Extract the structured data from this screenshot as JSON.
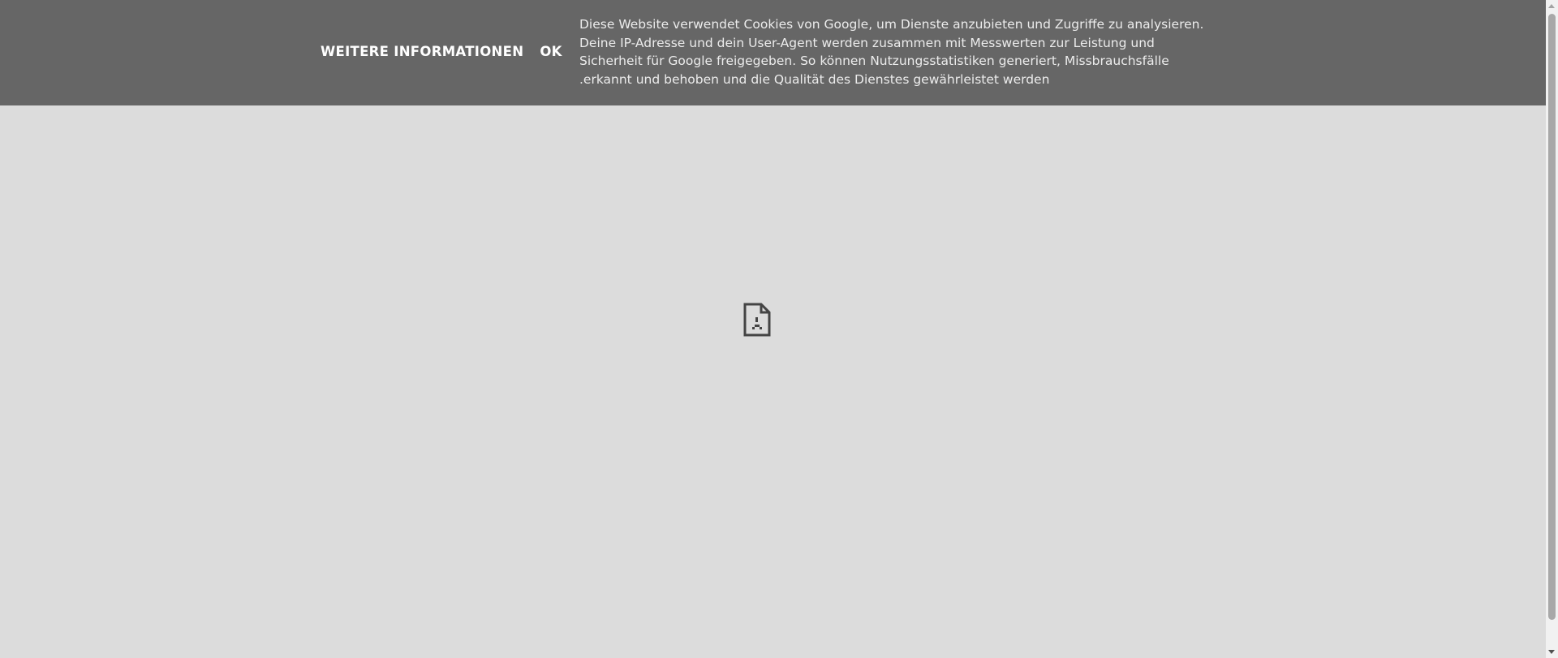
{
  "cookie_banner": {
    "more_info_label": "WEITERE INFORMATIONEN",
    "ok_label": "OK",
    "message": "Diese Website verwendet Cookies von Google, um Dienste anzubieten und Zugriffe zu analysieren.\nDeine IP-Adresse und dein User-Agent werden zusammen mit Messwerten zur Leistung und\nSicherheit für Google freigegeben. So können Nutzungsstatistiken generiert, Missbrauchsfälle\n.erkannt und behoben und die Qualität des Dienstes gewährleistet werden"
  },
  "main": {
    "icon": "broken-page-sad-face-icon"
  },
  "colors": {
    "banner_background": "#666666",
    "page_background": "#dcdcdc",
    "banner_text": "#ececec",
    "link_text": "#ffffff"
  }
}
